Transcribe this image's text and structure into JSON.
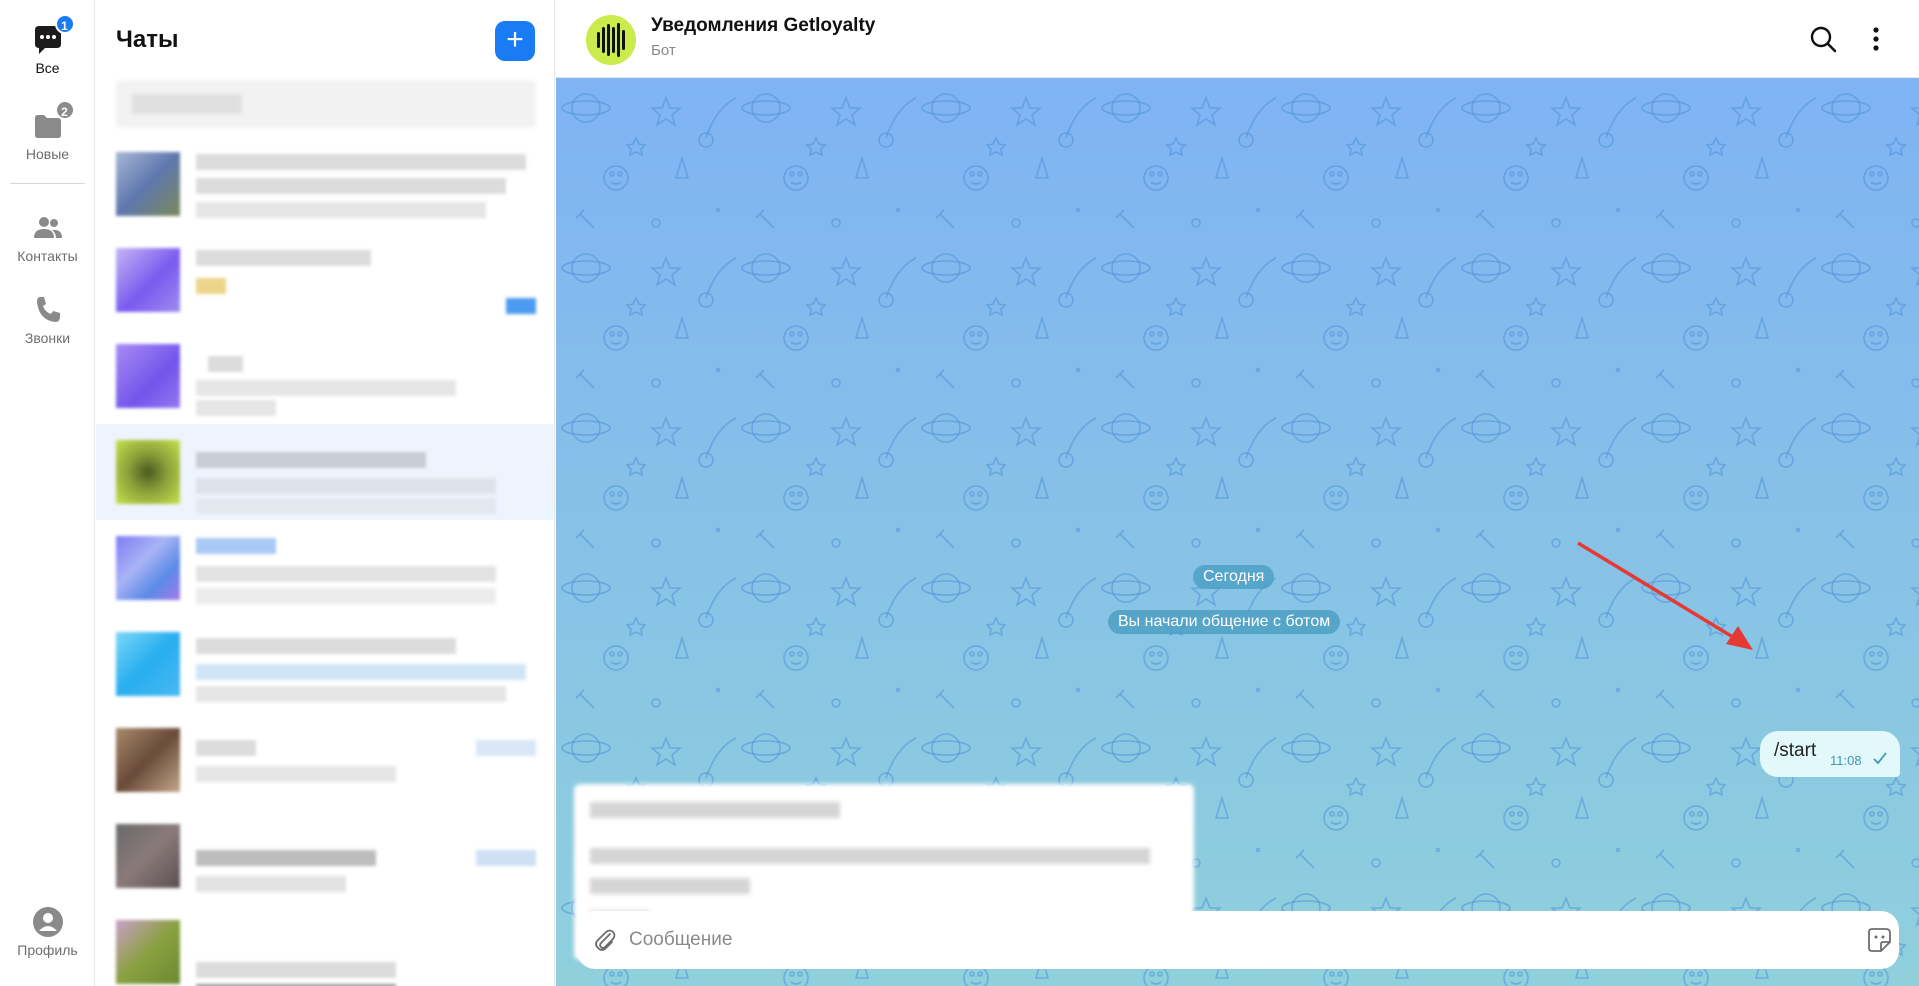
{
  "rail": {
    "items": [
      {
        "label": "Все",
        "badge": "1",
        "badge_color": "#1a7cf5",
        "icon": "chat-bubble-icon"
      },
      {
        "label": "Новые",
        "badge": "2",
        "badge_color": "#8c8c8c",
        "icon": "folder-icon"
      },
      {
        "label": "Контакты",
        "icon": "contacts-icon"
      },
      {
        "label": "Звонки",
        "icon": "phone-icon"
      }
    ],
    "profile_label": "Профиль"
  },
  "chatlist": {
    "title": "Чаты",
    "new_chat_symbol": "+"
  },
  "conversation": {
    "name": "Уведомления Getloyalty",
    "subtitle": "Бот",
    "date_pill": "Сегодня",
    "service_message": "Вы начали общение с ботом",
    "outgoing_message": {
      "text": "/start",
      "time": "11:08"
    },
    "composer_placeholder": "Сообщение"
  },
  "colors": {
    "accent": "#1a7cf5",
    "bot_avatar": "#cbea4b",
    "annotation_arrow": "#e53935",
    "outgoing_bubble": "#e2f8fb"
  }
}
